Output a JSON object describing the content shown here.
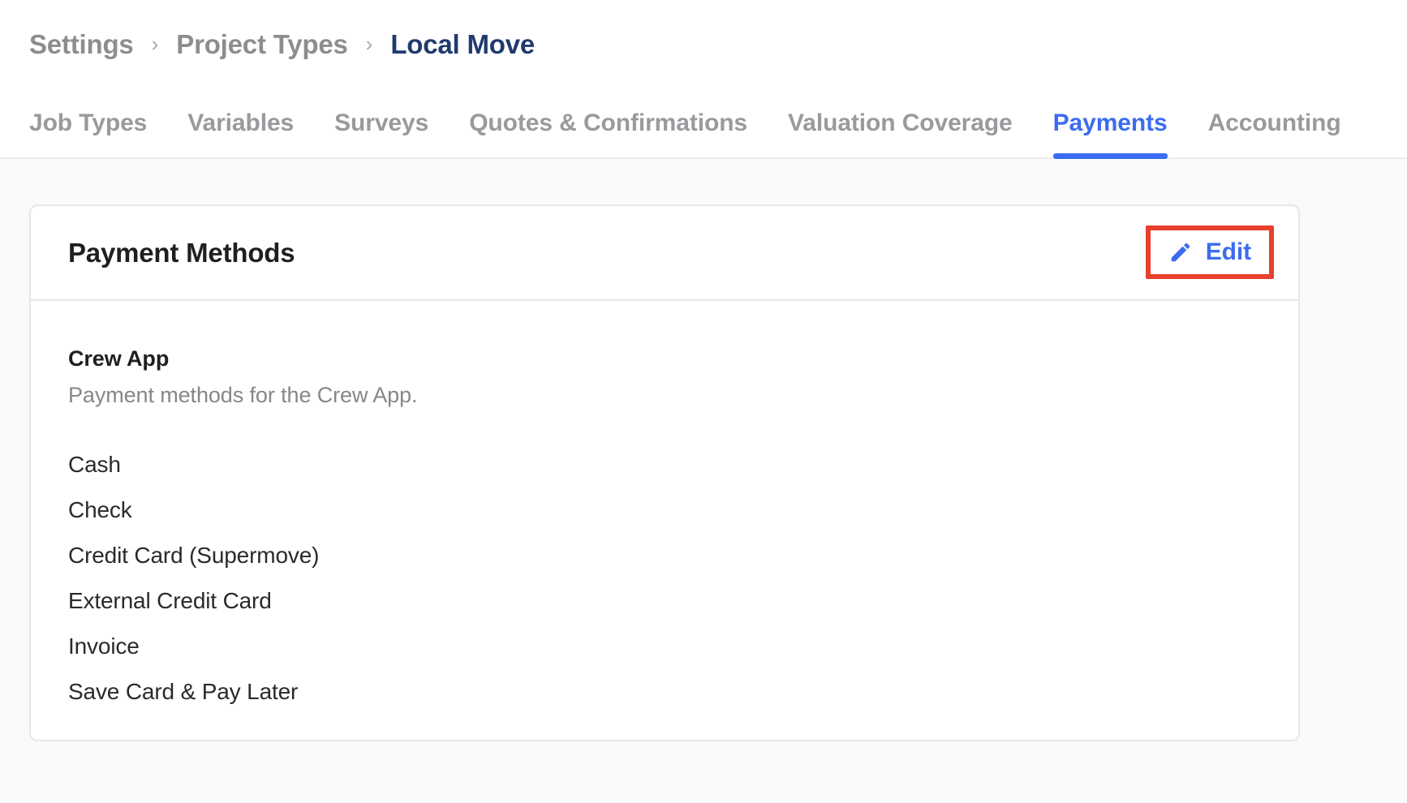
{
  "breadcrumb": {
    "separator": "›",
    "items": [
      {
        "label": "Settings",
        "current": false
      },
      {
        "label": "Project Types",
        "current": false
      },
      {
        "label": "Local Move",
        "current": true
      }
    ]
  },
  "tabs": [
    {
      "label": "Job Types",
      "active": false
    },
    {
      "label": "Variables",
      "active": false
    },
    {
      "label": "Surveys",
      "active": false
    },
    {
      "label": "Quotes & Confirmations",
      "active": false
    },
    {
      "label": "Valuation Coverage",
      "active": false
    },
    {
      "label": "Payments",
      "active": true
    },
    {
      "label": "Accounting",
      "active": false
    }
  ],
  "card": {
    "title": "Payment Methods",
    "edit_button": {
      "label": "Edit",
      "icon": "pencil-icon",
      "highlighted": true
    },
    "section": {
      "title": "Crew App",
      "subtitle": "Payment methods for the Crew App.",
      "methods": [
        "Cash",
        "Check",
        "Credit Card (Supermove)",
        "External Credit Card",
        "Invoice",
        "Save Card & Pay Later"
      ]
    }
  },
  "colors": {
    "accent_blue": "#3b6cf0",
    "breadcrumb_current": "#1f3a6e",
    "muted_text": "#8d8d90",
    "highlight_red": "#e8402a",
    "page_background": "#fafafa",
    "card_background": "#ffffff",
    "border": "#e7e7e8"
  }
}
